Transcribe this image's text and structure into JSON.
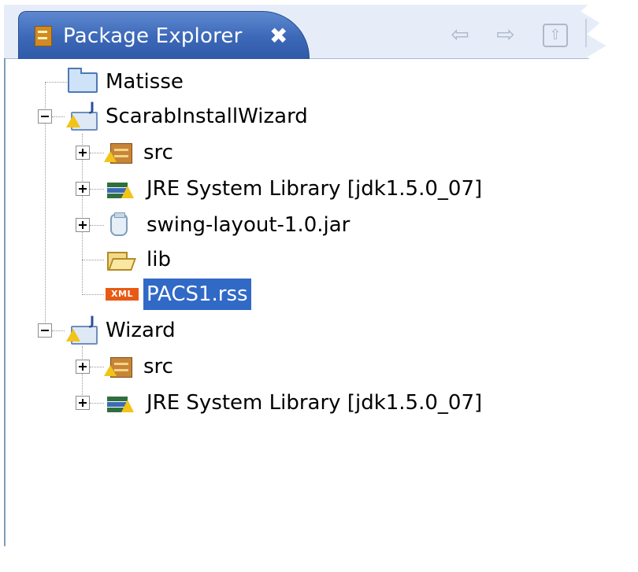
{
  "view": {
    "title": "Package Explorer",
    "close_glyph": "✖",
    "toolbar": {
      "back_icon": "back-arrow-icon",
      "forward_icon": "forward-arrow-icon",
      "up_icon": "collapse-up-icon"
    }
  },
  "tree": [
    {
      "label": "Matisse",
      "icon": "folder-icon",
      "expandable": false
    },
    {
      "label": "ScarabInstallWizard",
      "icon": "java-project-icon",
      "expandable": true,
      "expanded": true,
      "children": [
        {
          "label": "src",
          "icon": "package-icon",
          "expandable": true
        },
        {
          "label": "JRE System Library [jdk1.5.0_07]",
          "icon": "library-icon",
          "expandable": true
        },
        {
          "label": "swing-layout-1.0.jar",
          "icon": "jar-icon",
          "expandable": true
        },
        {
          "label": "lib",
          "icon": "open-folder-icon",
          "expandable": false
        },
        {
          "label": "PACS1.rss",
          "icon": "xml-file-icon",
          "expandable": false,
          "selected": true,
          "badge": "XML"
        }
      ]
    },
    {
      "label": "Wizard",
      "icon": "java-project-icon",
      "expandable": true,
      "expanded": true,
      "children": [
        {
          "label": "src",
          "icon": "package-icon",
          "expandable": true
        },
        {
          "label": "JRE System Library [jdk1.5.0_07]",
          "icon": "library-icon",
          "expandable": true
        }
      ]
    }
  ],
  "colors": {
    "tab_active": "#3c68b8",
    "selection": "#3169c6",
    "warning": "#f2c318"
  }
}
